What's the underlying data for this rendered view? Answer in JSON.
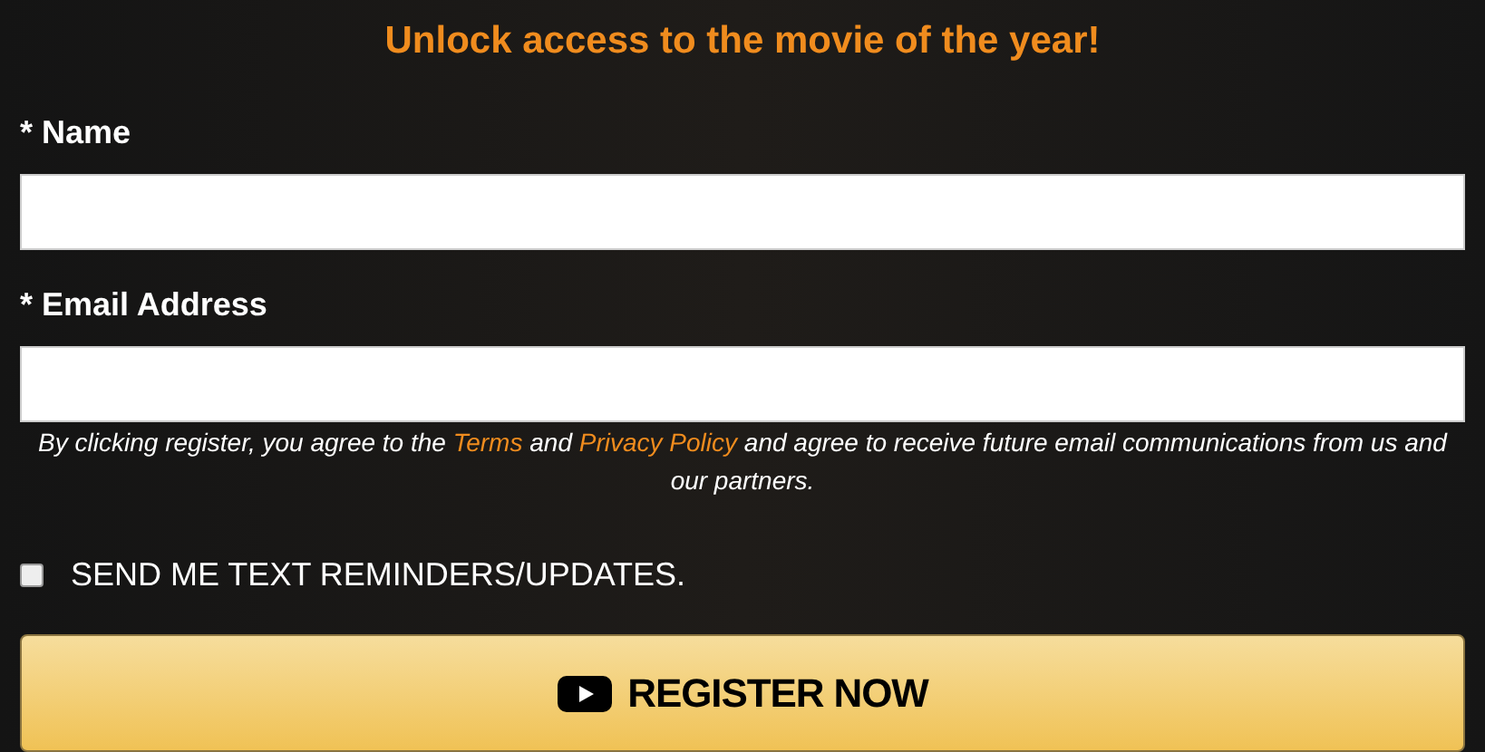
{
  "heading": "Unlock access to the movie of the year!",
  "fields": [
    {
      "label": "* Name"
    },
    {
      "label": "* Email Address"
    }
  ],
  "consent": {
    "before": "By clicking register, you agree to the",
    "terms_link": "Terms",
    "middle": "and",
    "privacy_link": "Privacy Policy",
    "after": "and agree to receive future email communications from us and our partners."
  },
  "sms_option": {
    "label": "SEND ME TEXT REMINDERS/UPDATES.",
    "checked": false
  },
  "submit_button": {
    "label": "REGISTER NOW"
  }
}
